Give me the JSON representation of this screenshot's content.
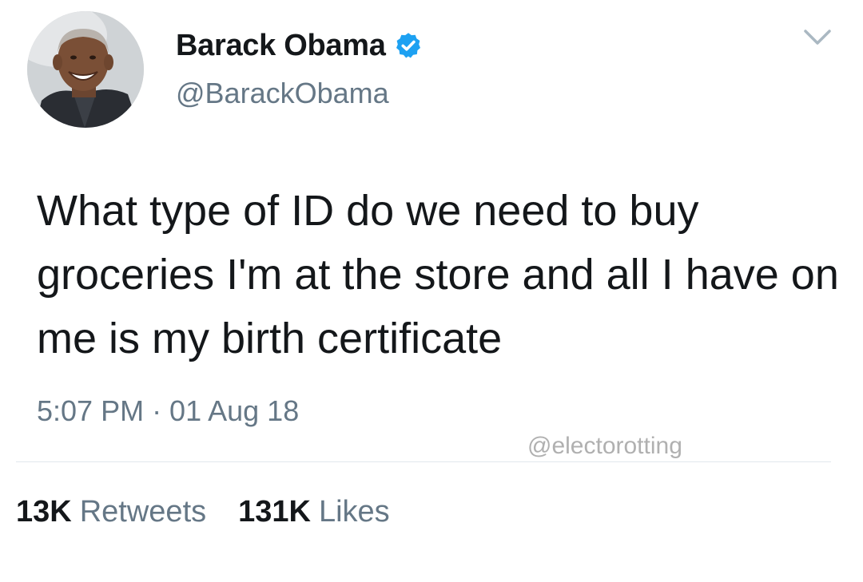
{
  "author": {
    "display_name": "Barack Obama",
    "handle": "@BarackObama",
    "verified": true,
    "verified_color": "#1da1f2",
    "avatar_icon": "profile-photo"
  },
  "tweet": {
    "text": "What type of ID do we need to buy groceries I'm at the store and all I have on me is my birth certificate",
    "timestamp": "5:07 PM · 01 Aug 18"
  },
  "watermark": "@electorotting",
  "stats": {
    "retweets_count": "13K",
    "retweets_label": "Retweets",
    "likes_count": "131K",
    "likes_label": "Likes"
  },
  "menu_icon": "chevron-down-icon"
}
